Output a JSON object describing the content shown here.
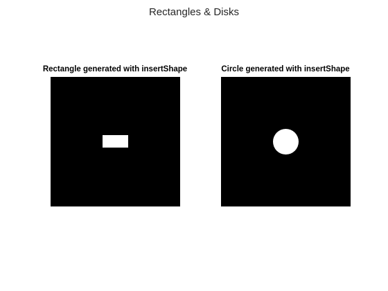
{
  "figure": {
    "title": "Rectangles & Disks"
  },
  "panels": [
    {
      "title": "Rectangle generated with insertShape",
      "shape": "rectangle",
      "background_color": "#000000",
      "shape_color": "#ffffff"
    },
    {
      "title": "Circle generated with insertShape",
      "shape": "circle",
      "background_color": "#000000",
      "shape_color": "#ffffff"
    }
  ]
}
